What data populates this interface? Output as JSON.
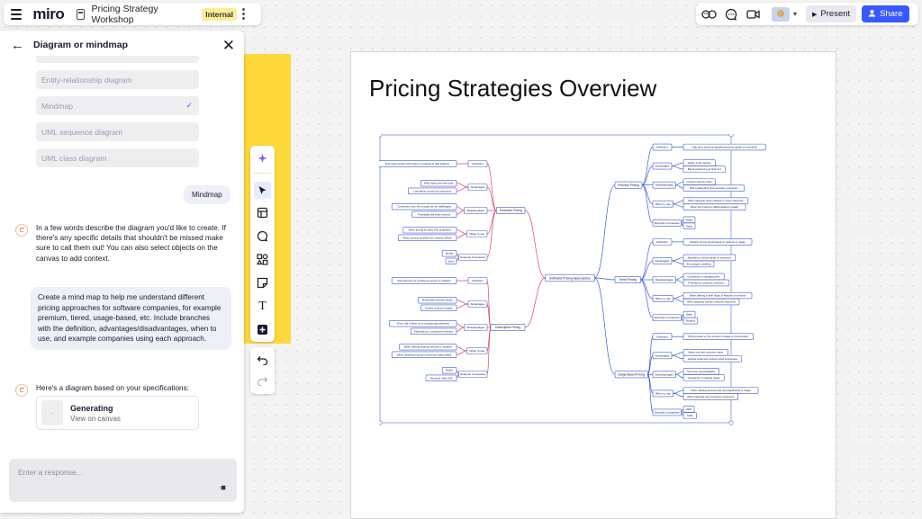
{
  "app": {
    "logo": "miro",
    "board_title": "Pricing Strategy Workshop",
    "badge": "Internal"
  },
  "topbar": {
    "present_label": "Present",
    "share_label": "Share"
  },
  "panel": {
    "title": "Diagram or mindmap",
    "options": [
      {
        "label": "Entity-relationship diagram",
        "selected": false
      },
      {
        "label": "Mindmap",
        "selected": true
      },
      {
        "label": "UML sequence diagram",
        "selected": false
      },
      {
        "label": "UML class diagram",
        "selected": false
      }
    ],
    "user_choice": "Mindmap",
    "ai_prompt": "In a few words describe the diagram you'd like to create. If there's any specific details that shouldn't be missed make sure to call them out! You can also select objects on the canvas to add context.",
    "user_request": "Create a mind map to help me understand different pricing approaches for software companies, for example premium, tiered, usage-based, etc. Include branches with the definition, advantages/disadvantages, when to use, and example companies using each approach.",
    "ai_result": "Here's a diagram based on your specifications:",
    "generating_title": "Generating",
    "generating_sub": "View on canvas",
    "input_placeholder": "Enter a response..."
  },
  "canvas": {
    "frame_title": "Pricing Strategies Overview",
    "mindmap": {
      "root": "Software Pricing Approaches",
      "left_branches": [
        {
          "name": "Freemium Pricing",
          "children": [
            {
              "name": "Definition",
              "leaves": [
                "Free basic version with option to upgrade to paid features"
              ]
            },
            {
              "name": "Advantages",
              "leaves": [
                "Wide reach and user base",
                "Low barrier to entry for customers"
              ]
            },
            {
              "name": "Disadvantages",
              "leaves": [
                "Conversion from free to paid can be challenging",
                "Potentially low initial revenue"
              ]
            },
            {
              "name": "When to use",
              "leaves": [
                "When aiming for rapid user acquisition",
                "When product benefits from network effects"
              ]
            },
            {
              "name": "Example Companies",
              "leaves": [
                "Spotify",
                "Zoom"
              ]
            }
          ]
        },
        {
          "name": "Subscription Pricing",
          "children": [
            {
              "name": "Definition",
              "leaves": [
                "Recurring fee for continuous access to software"
              ]
            },
            {
              "name": "Advantages",
              "leaves": [
                "Predictable revenue stream",
                "Fosters customer loyalty"
              ]
            },
            {
              "name": "Disadvantages",
              "leaves": [
                "Churn risk if value is not continuously delivered",
                "Dependency on customer retention"
              ]
            },
            {
              "name": "When to use",
              "leaves": [
                "When offering ongoing services or updates",
                "When targeting long-term customer relationships"
              ]
            },
            {
              "name": "Example Companies",
              "leaves": [
                "Netflix",
                "Microsoft Office 365"
              ]
            }
          ]
        }
      ],
      "right_branches": [
        {
          "name": "Premium Pricing",
          "children": [
            {
              "name": "Definition",
              "leaves": [
                "High price aimed at signaling superior quality or exclusivity"
              ]
            },
            {
              "name": "Advantages",
              "leaves": [
                "Higher profit margins",
                "Brand positioning as high end"
              ]
            },
            {
              "name": "Disadvantages",
              "leaves": [
                "Limited customer base",
                "Risk of alienating price-sensitive customers"
              ]
            },
            {
              "name": "When to use",
              "leaves": [
                "When targeting niche markets or luxury segments",
                "When the product is differentiated in quality"
              ]
            },
            {
              "name": "Example Companies",
              "leaves": [
                "Adobe",
                "Apple"
              ]
            }
          ]
        },
        {
          "name": "Tiered Pricing",
          "children": [
            {
              "name": "Definition",
              "leaves": [
                "Multiple pricing levels based on features or usage"
              ]
            },
            {
              "name": "Advantages",
              "leaves": [
                "Appeals to a broad range of customers",
                "Encourages upselling"
              ]
            },
            {
              "name": "Disadvantages",
              "leaves": [
                "Complexity in managing tiers",
                "Potential for customer confusion"
              ]
            },
            {
              "name": "When to use",
              "leaves": [
                "When offering a wide range of features or services",
                "When targeting diverse customer segments"
              ]
            },
            {
              "name": "Example Companies",
              "leaves": [
                "Slack",
                "Dropbox"
              ]
            }
          ]
        },
        {
          "name": "Usage-Based Pricing",
          "children": [
            {
              "name": "Definition",
              "leaves": [
                "Pricing based on the amount of usage or consumption"
              ]
            },
            {
              "name": "Advantages",
              "leaves": [
                "Aligns cost with customer value",
                "Attracts small and medium-sized businesses"
              ]
            },
            {
              "name": "Disadvantages",
              "leaves": [
                "Revenue unpredictability",
                "Complexity in tracking usage"
              ]
            },
            {
              "name": "When to use",
              "leaves": [
                "When offering services that vary significantly in usage",
                "When targeting cost-conscious customers"
              ]
            },
            {
              "name": "Example Companies",
              "leaves": [
                "AWS",
                "Twilio"
              ]
            }
          ]
        }
      ]
    }
  },
  "colors": {
    "accent": "#3859ff",
    "sticky_yellow": "#fcd83a",
    "branch_left": "#d9436b",
    "branch_right": "#3f5bd9"
  }
}
